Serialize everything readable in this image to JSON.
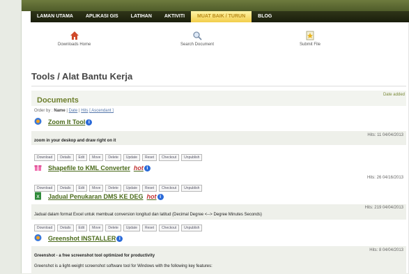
{
  "nav": {
    "items": [
      "LAMAN UTAMA",
      "APLIKASI GIS",
      "LATIHAN",
      "AKTIVITI",
      "MUAT BAIK / TURUN",
      "BLOG"
    ],
    "active_index": 4
  },
  "quicklinks": {
    "downloads_home": "Downloads Home",
    "search_document": "Search Document",
    "submit_file": "Submit File"
  },
  "page": {
    "title": "Tools / Alat Bantu Kerja",
    "section_title": "Documents",
    "date_added": "Date added",
    "order_by": {
      "prefix": "Order by :",
      "name": "Name",
      "sep1": "|",
      "date": "Date",
      "sep2": "|",
      "hits": "Hits",
      "ascendant": "[ Ascendant ]"
    }
  },
  "actions": [
    "Download",
    "Details",
    "Edit",
    "Move",
    "Delete",
    "Update",
    "Reset",
    "Checkout",
    "Unpublish"
  ],
  "documents": [
    {
      "title": "Zoom It Tool",
      "hot": "",
      "desc": "zoom in your deskop and draw right on it",
      "desc2": "",
      "hits": "Hits: 11 04/04/2013"
    },
    {
      "title": "Shapefile to KML Converter",
      "hot": "hot",
      "desc": "",
      "desc2": "",
      "hits": "Hits: 26 04/16/2013"
    },
    {
      "title": "Jadual Penukaran DMS KE DEG",
      "hot": "hot",
      "desc": "Jadual dalam format Excel untuk membuat conversion longitud dan latitud (Decimal Degree <--> Degree Minutes Seconds)",
      "desc2": "",
      "hits": "Hits: 219 04/04/2013"
    },
    {
      "title": "Greenshot INSTALLER",
      "hot": "",
      "desc": "Greenshot - a free screenshot tool optimized for productivity",
      "desc2": "Greenshot is a light-weight screenshot software tool for Windows with the following key features:",
      "hits": "Hits: 8 04/04/2013"
    }
  ],
  "colors": {
    "nav_bg": "#1a1e0c",
    "active_tab": "#f2cd4a",
    "link_green": "#4a6a1a",
    "info_blue": "#2a6ad8"
  }
}
